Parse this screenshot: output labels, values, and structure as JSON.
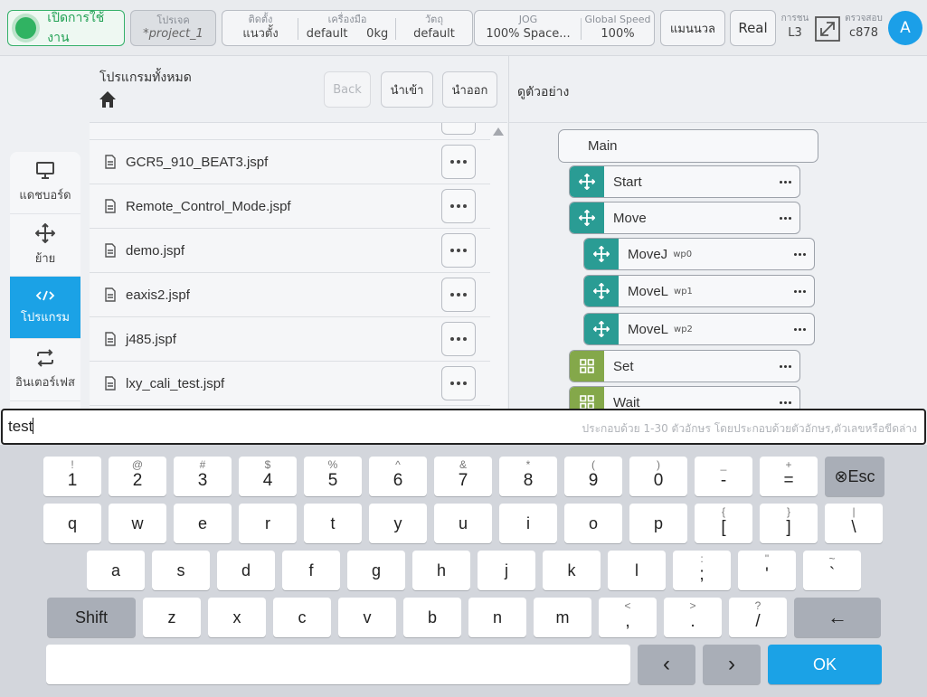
{
  "topbar": {
    "enable_label": "เปิดการใช้งาน",
    "project": {
      "caption": "โปรเจค",
      "value": "*project_1"
    },
    "config": [
      {
        "caption": "ติดตั้ง",
        "value": "แนวตั้ง"
      },
      {
        "caption": "เครื่องมือ",
        "value": "default     0kg"
      },
      {
        "caption": "วัตถุ",
        "value": "default"
      }
    ],
    "jog": {
      "caption": "JOG",
      "value": "100%  Space..."
    },
    "global_speed": {
      "caption": "Global Speed",
      "value": "100%"
    },
    "manual_label": "แมนนวล",
    "real_label": "Real",
    "collision": {
      "caption": "การชน",
      "value": "L3"
    },
    "verify": {
      "caption": "ตรวจสอบ",
      "value": "c878"
    },
    "avatar_letter": "A"
  },
  "sidenav": [
    {
      "label": "แดชบอร์ด",
      "icon": "monitor-icon",
      "active": false
    },
    {
      "label": "ย้าย",
      "icon": "move-icon",
      "active": false
    },
    {
      "label": "โปรแกรม",
      "icon": "code-icon",
      "active": true
    },
    {
      "label": "อินเตอร์เฟส",
      "icon": "swap-icon",
      "active": false
    }
  ],
  "files": {
    "title": "โปรแกรมทั้งหมด",
    "back_label": "Back",
    "import_label": "นำเข้า",
    "export_label": "นำออก",
    "items": [
      "GCR5_910_BEAT3.jspf",
      "Remote_Control_Mode.jspf",
      "demo.jspf",
      "eaxis2.jspf",
      "j485.jspf",
      "lxy_cali_test.jspf"
    ]
  },
  "preview": {
    "title": "ดูตัวอย่าง",
    "main_label": "Main",
    "nodes": [
      {
        "label": "Start",
        "wp": "",
        "kind": "move"
      },
      {
        "label": "Move",
        "wp": "",
        "kind": "move"
      },
      {
        "label": "MoveJ",
        "wp": "wp0",
        "kind": "move"
      },
      {
        "label": "MoveL",
        "wp": "wp1",
        "kind": "move"
      },
      {
        "label": "MoveL",
        "wp": "wp2",
        "kind": "move"
      },
      {
        "label": "Set",
        "wp": "",
        "kind": "grid"
      },
      {
        "label": "Wait",
        "wp": "",
        "kind": "grid"
      }
    ]
  },
  "input": {
    "value": "test",
    "hint": "ประกอบด้วย 1-30 ตัวอักษร โดยประกอบด้วยตัวอักษร,ตัวเลขหรือขีดล่าง"
  },
  "keyboard": {
    "row1": [
      {
        "sup": "!",
        "main": "1"
      },
      {
        "sup": "@",
        "main": "2"
      },
      {
        "sup": "#",
        "main": "3"
      },
      {
        "sup": "$",
        "main": "4"
      },
      {
        "sup": "%",
        "main": "5"
      },
      {
        "sup": "^",
        "main": "6"
      },
      {
        "sup": "&",
        "main": "7"
      },
      {
        "sup": "*",
        "main": "8"
      },
      {
        "sup": "(",
        "main": "9"
      },
      {
        "sup": ")",
        "main": "0"
      },
      {
        "sup": "_",
        "main": "-"
      },
      {
        "sup": "+",
        "main": "="
      }
    ],
    "esc_label": "⊗Esc",
    "row2": [
      {
        "sup": "",
        "main": "q"
      },
      {
        "sup": "",
        "main": "w"
      },
      {
        "sup": "",
        "main": "e"
      },
      {
        "sup": "",
        "main": "r"
      },
      {
        "sup": "",
        "main": "t"
      },
      {
        "sup": "",
        "main": "y"
      },
      {
        "sup": "",
        "main": "u"
      },
      {
        "sup": "",
        "main": "i"
      },
      {
        "sup": "",
        "main": "o"
      },
      {
        "sup": "",
        "main": "p"
      },
      {
        "sup": "{",
        "main": "["
      },
      {
        "sup": "}",
        "main": "]"
      },
      {
        "sup": "|",
        "main": "\\"
      }
    ],
    "row3": [
      {
        "sup": "",
        "main": "a"
      },
      {
        "sup": "",
        "main": "s"
      },
      {
        "sup": "",
        "main": "d"
      },
      {
        "sup": "",
        "main": "f"
      },
      {
        "sup": "",
        "main": "g"
      },
      {
        "sup": "",
        "main": "h"
      },
      {
        "sup": "",
        "main": "j"
      },
      {
        "sup": "",
        "main": "k"
      },
      {
        "sup": "",
        "main": "l"
      },
      {
        "sup": ":",
        "main": ";"
      },
      {
        "sup": "\"",
        "main": "'"
      },
      {
        "sup": "~",
        "main": "`"
      }
    ],
    "shift_label": "Shift",
    "row4": [
      {
        "sup": "",
        "main": "z"
      },
      {
        "sup": "",
        "main": "x"
      },
      {
        "sup": "",
        "main": "c"
      },
      {
        "sup": "",
        "main": "v"
      },
      {
        "sup": "",
        "main": "b"
      },
      {
        "sup": "",
        "main": "n"
      },
      {
        "sup": "",
        "main": "m"
      },
      {
        "sup": "<",
        "main": ","
      },
      {
        "sup": ">",
        "main": "."
      },
      {
        "sup": "?",
        "main": "/"
      }
    ],
    "backspace_label": "←",
    "space_label": "",
    "left_label": "‹",
    "right_label": "›",
    "ok_label": "OK"
  }
}
